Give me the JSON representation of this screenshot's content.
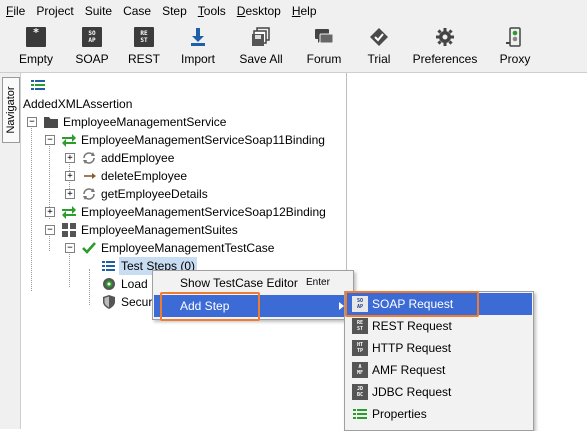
{
  "menubar": {
    "items": [
      {
        "label": "File",
        "mnemonic": "F"
      },
      {
        "label": "Project"
      },
      {
        "label": "Suite"
      },
      {
        "label": "Case"
      },
      {
        "label": "Step"
      },
      {
        "label": "Tools",
        "mnemonic": "T"
      },
      {
        "label": "Desktop",
        "mnemonic": "D"
      },
      {
        "label": "Help",
        "mnemonic": "H"
      }
    ]
  },
  "toolbar": {
    "empty": {
      "label": "Empty",
      "icon": "empty-project-icon",
      "glyph": "*"
    },
    "soap": {
      "label": "SOAP",
      "icon": "soap-icon",
      "glyph": "SO AP"
    },
    "rest": {
      "label": "REST",
      "icon": "rest-icon",
      "glyph": "RE ST"
    },
    "import": {
      "label": "Import",
      "icon": "import-icon"
    },
    "saveall": {
      "label": "Save All",
      "icon": "save-all-icon"
    },
    "forum": {
      "label": "Forum",
      "icon": "forum-icon"
    },
    "trial": {
      "label": "Trial",
      "icon": "trial-icon"
    },
    "preferences": {
      "label": "Preferences",
      "icon": "gear-icon"
    },
    "proxy": {
      "label": "Proxy",
      "icon": "proxy-icon"
    }
  },
  "navigator": {
    "tab_label": "Navigator"
  },
  "tree": {
    "root_label": "AddedXMLAssertion",
    "nodes": {
      "service": "EmployeeManagementService",
      "binding11": "EmployeeManagementServiceSoap11Binding",
      "add_employee": "addEmployee",
      "delete_employee": "deleteEmployee",
      "get_employee_details": "getEmployeeDetails",
      "binding12": "EmployeeManagementServiceSoap12Binding",
      "suites": "EmployeeManagementSuites",
      "testcase": "EmployeeManagementTestCase",
      "test_steps": "Test Steps (0)",
      "load": "Load",
      "security": "Secur"
    }
  },
  "context_menu": {
    "show_editor": {
      "label": "Show TestCase Editor",
      "shortcut": "Enter"
    },
    "add_step": {
      "label": "Add Step"
    }
  },
  "submenu": {
    "items": [
      {
        "label": "SOAP Request",
        "icon": "soap-request-icon",
        "glyph": "SO AP"
      },
      {
        "label": "REST Request",
        "icon": "rest-request-icon",
        "glyph": "RE ST"
      },
      {
        "label": "HTTP Request",
        "icon": "http-request-icon",
        "glyph": "HT TP"
      },
      {
        "label": "AMF Request",
        "icon": "amf-request-icon",
        "glyph": "A MF"
      },
      {
        "label": "JDBC Request",
        "icon": "jdbc-request-icon",
        "glyph": "JD BC"
      },
      {
        "label": "Properties",
        "icon": "properties-icon"
      }
    ]
  },
  "colors": {
    "selection": "#3d6bd6",
    "highlight_box": "#ee7d31",
    "green": "#2a9d2a"
  }
}
